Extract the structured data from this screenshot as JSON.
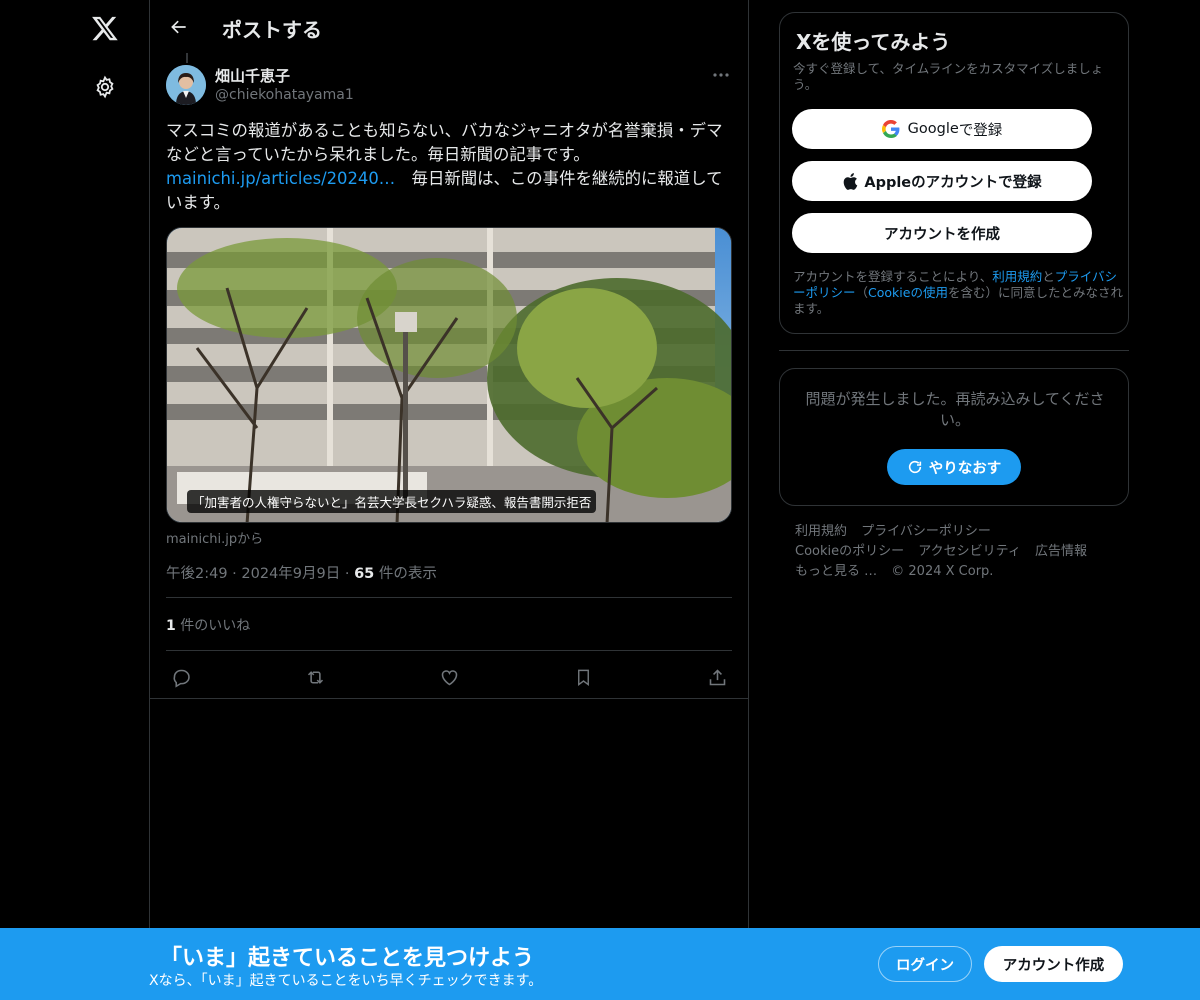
{
  "header": {
    "title": "ポストする"
  },
  "post": {
    "author_name": "畑山千恵子",
    "author_handle": "@chiekohatayama1",
    "text_part1": "マスコミの報道があることも知らない、バカなジャニオタが名誉棄損・デマなどと言っていたから呆れました。毎日新聞の記事です。",
    "link_text": "mainichi.jp/articles/20240…",
    "text_part2": "　毎日新聞は、この事件を継続的に報道しています。",
    "card_caption": "「加害者の人権守らないと」名芸大学長セクハラ疑惑、報告書開示拒否",
    "card_source": "mainichi.jpから",
    "time": "午後2:49",
    "date": "2024年9月9日",
    "separator": "·",
    "views_count": "65",
    "views_label": " 件の表示",
    "likes_count": "1",
    "likes_label": " 件のいいね"
  },
  "signup": {
    "title": "Xを使ってみよう",
    "subtitle": "今すぐ登録して、タイムラインをカスタマイズしましょう。",
    "google_brand": "Google",
    "google_suffix": " で登録",
    "apple_label": "Appleのアカウントで登録",
    "create_label": "アカウントを作成",
    "terms_prefix": "アカウントを登録することにより、",
    "terms_link1": "利用規約",
    "terms_and": "と",
    "terms_link2": "プライバシーポリシー",
    "terms_paren_open": "（",
    "terms_link3": "Cookieの使用",
    "terms_suffix": "を含む）に同意したとみなされます。"
  },
  "error": {
    "message": "問題が発生しました。再読み込みしてください。",
    "retry_label": "やりなおす"
  },
  "footer": {
    "links": [
      "利用規約",
      "プライバシーポリシー",
      "Cookieのポリシー",
      "アクセシビリティ",
      "広告情報",
      "もっと見る …"
    ],
    "copyright": "© 2024 X Corp."
  },
  "bottom_bar": {
    "title": "「いま」起きていることを見つけよう",
    "subtitle": "Xなら、「いま」起きていることをいち早くチェックできます。",
    "login_label": "ログイン",
    "signup_label": "アカウント作成"
  },
  "colors": {
    "accent": "#1d9bf0",
    "background": "#000000",
    "border": "#2f3336",
    "text_primary": "#e7e9ea",
    "text_secondary": "#71767b"
  }
}
